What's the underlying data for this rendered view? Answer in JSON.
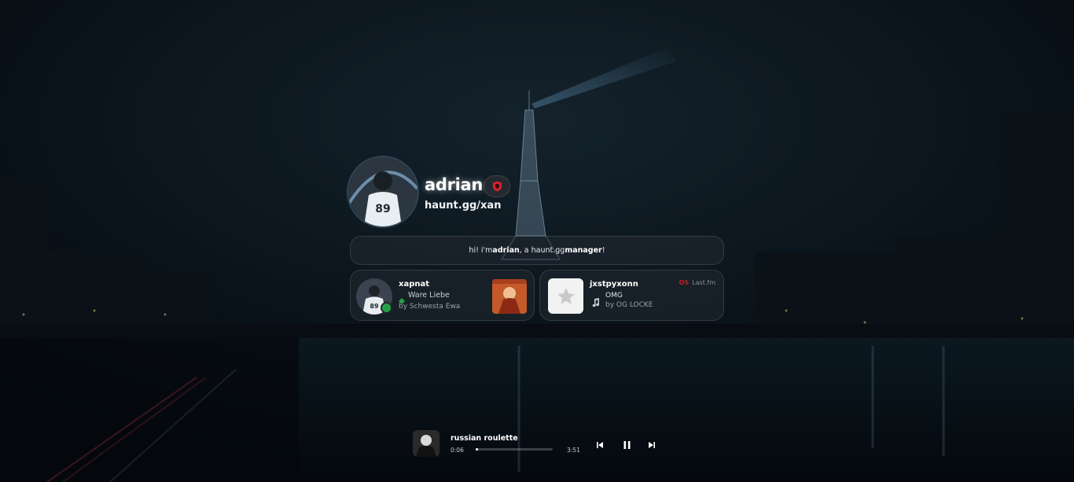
{
  "profile": {
    "username": "adrian",
    "handle": "haunt.gg/xan",
    "badge_icon": "shield-icon"
  },
  "bio": {
    "prefix": "hi! i'm ",
    "name": "adrian",
    "middle": ", a haunt.gg ",
    "role": "manager",
    "suffix": "!"
  },
  "cards": {
    "discord": {
      "username": "xapnat",
      "song": "Ware Liebe",
      "artist": "by Schwesta Ewa",
      "status_color": "#24a148"
    },
    "lastfm": {
      "username": "jxstpyxonn",
      "service": "Last.fm",
      "service_logo": "OS",
      "song": "OMG",
      "artist": "by OG LOCKE"
    }
  },
  "player": {
    "title": "russian roulette",
    "current": "0:06",
    "duration": "3:51",
    "progress": 0.027
  },
  "colors": {
    "accent": "#24a148",
    "lastfm_red": "#c81c1c",
    "badge_red": "#d6222f"
  }
}
